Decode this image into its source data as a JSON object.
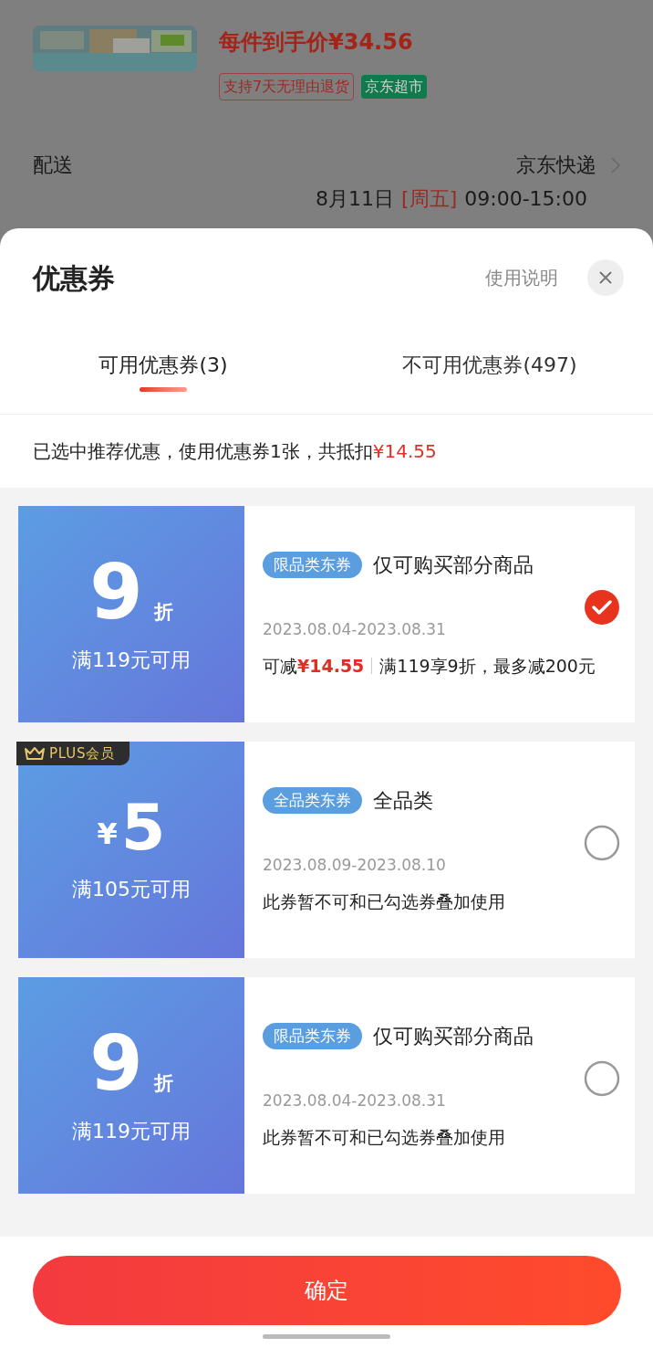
{
  "background": {
    "price": "每件到手价¥34.56",
    "tags": [
      {
        "label": "支持7天无理由退货",
        "kind": "outline"
      },
      {
        "label": "京东超市",
        "kind": "solid"
      }
    ],
    "delivery_label": "配送",
    "delivery_method": "京东快递",
    "delivery_date": "8月11日",
    "delivery_weekday": "[周五]",
    "delivery_time": "09:00-15:00"
  },
  "sheet": {
    "title": "优惠券",
    "help_link": "使用说明",
    "tabs": [
      {
        "label": "可用优惠券(3)",
        "selected": true
      },
      {
        "label": "不可用优惠券(497)",
        "selected": false
      }
    ],
    "summary": "已选中推荐优惠，使用优惠券1张，共抵扣",
    "summary_amount": "¥14.55",
    "coupons": [
      {
        "kind": "discount",
        "value": "9",
        "unit": "折",
        "threshold": "满119元可用",
        "tag": "限品类东券",
        "title": "仅可购买部分商品",
        "dates": "2023.08.04-2023.08.31",
        "saving_label": "可减",
        "saving": "¥14.55",
        "detail": "满119享9折，最多减200元",
        "selected": true
      },
      {
        "kind": "amount",
        "badge": "PLUS会员",
        "unit": "¥",
        "value": "5",
        "threshold": "满105元可用",
        "tag": "全品类东券",
        "title": "全品类",
        "dates": "2023.08.09-2023.08.10",
        "detail": "此券暂不可和已勾选券叠加使用",
        "selected": false
      },
      {
        "kind": "discount",
        "value": "9",
        "unit": "折",
        "threshold": "满119元可用",
        "tag": "限品类东券",
        "title": "仅可购买部分商品",
        "dates": "2023.08.04-2023.08.31",
        "detail": "此券暂不可和已勾选券叠加使用",
        "selected": false
      }
    ],
    "confirm_button": "确定"
  }
}
